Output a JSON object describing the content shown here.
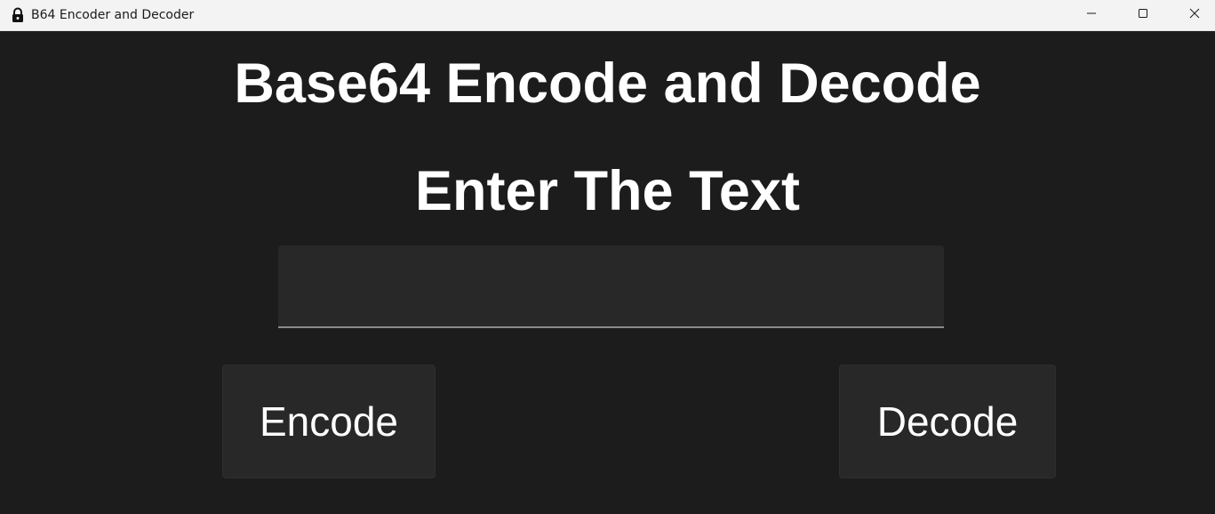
{
  "window": {
    "title": "B64 Encoder and Decoder",
    "icon": "lock-icon",
    "controls": [
      "minimize-icon",
      "maximize-icon",
      "close-icon"
    ]
  },
  "main": {
    "heading": "Base64 Encode and Decode",
    "subheading": "Enter The Text",
    "input": {
      "value": "",
      "placeholder": ""
    },
    "encode_label": "Encode",
    "decode_label": "Decode"
  },
  "colors": {
    "background": "#1c1c1c",
    "surface": "#282828",
    "text": "#ffffff",
    "titlebar": "#f3f3f3"
  }
}
